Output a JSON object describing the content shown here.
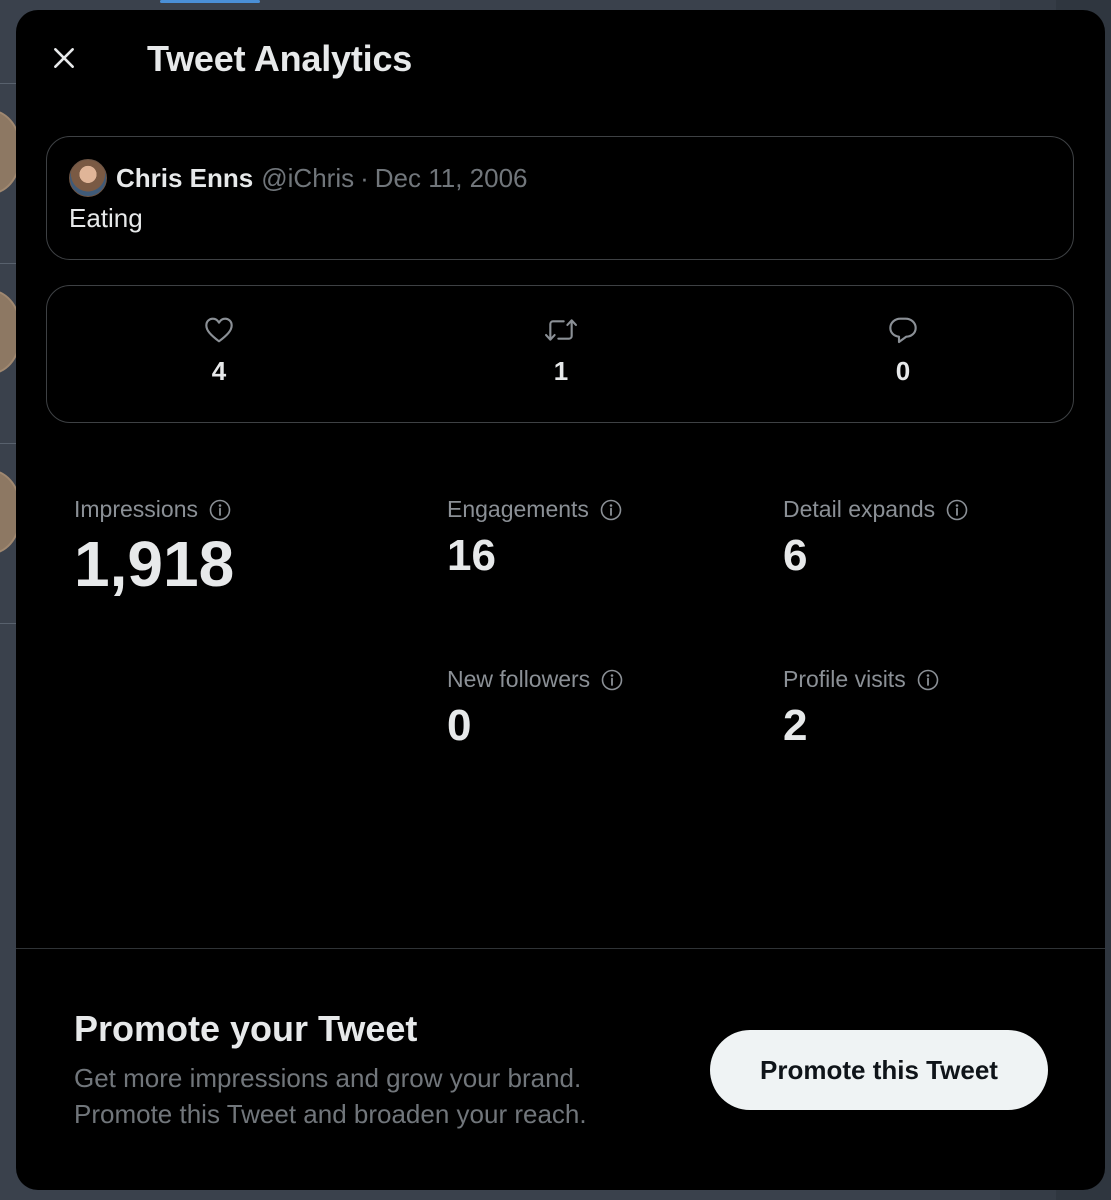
{
  "modal": {
    "title": "Tweet Analytics",
    "close_icon": "close-icon"
  },
  "tweet": {
    "author_name": "Chris Enns",
    "handle": "@iChris",
    "separator": "·",
    "date": "Dec 11, 2006",
    "text": "Eating"
  },
  "engagement": {
    "likes": {
      "icon": "heart-icon",
      "count": "4"
    },
    "retweets": {
      "icon": "retweet-icon",
      "count": "1"
    },
    "replies": {
      "icon": "reply-icon",
      "count": "0"
    }
  },
  "metrics": {
    "impressions": {
      "label": "Impressions",
      "value": "1,918"
    },
    "engagements": {
      "label": "Engagements",
      "value": "16"
    },
    "detail_expands": {
      "label": "Detail expands",
      "value": "6"
    },
    "new_followers": {
      "label": "New followers",
      "value": "0"
    },
    "profile_visits": {
      "label": "Profile visits",
      "value": "2"
    }
  },
  "promote": {
    "title": "Promote your Tweet",
    "description_line1": "Get more impressions and grow your brand.",
    "description_line2": "Promote this Tweet and broaden your reach.",
    "button_label": "Promote this Tweet"
  },
  "colors": {
    "modal_background": "#000000",
    "primary_text": "#e7e9ea",
    "secondary_text": "#71767b",
    "border": "#3e4144",
    "button_background": "#eff3f4"
  }
}
